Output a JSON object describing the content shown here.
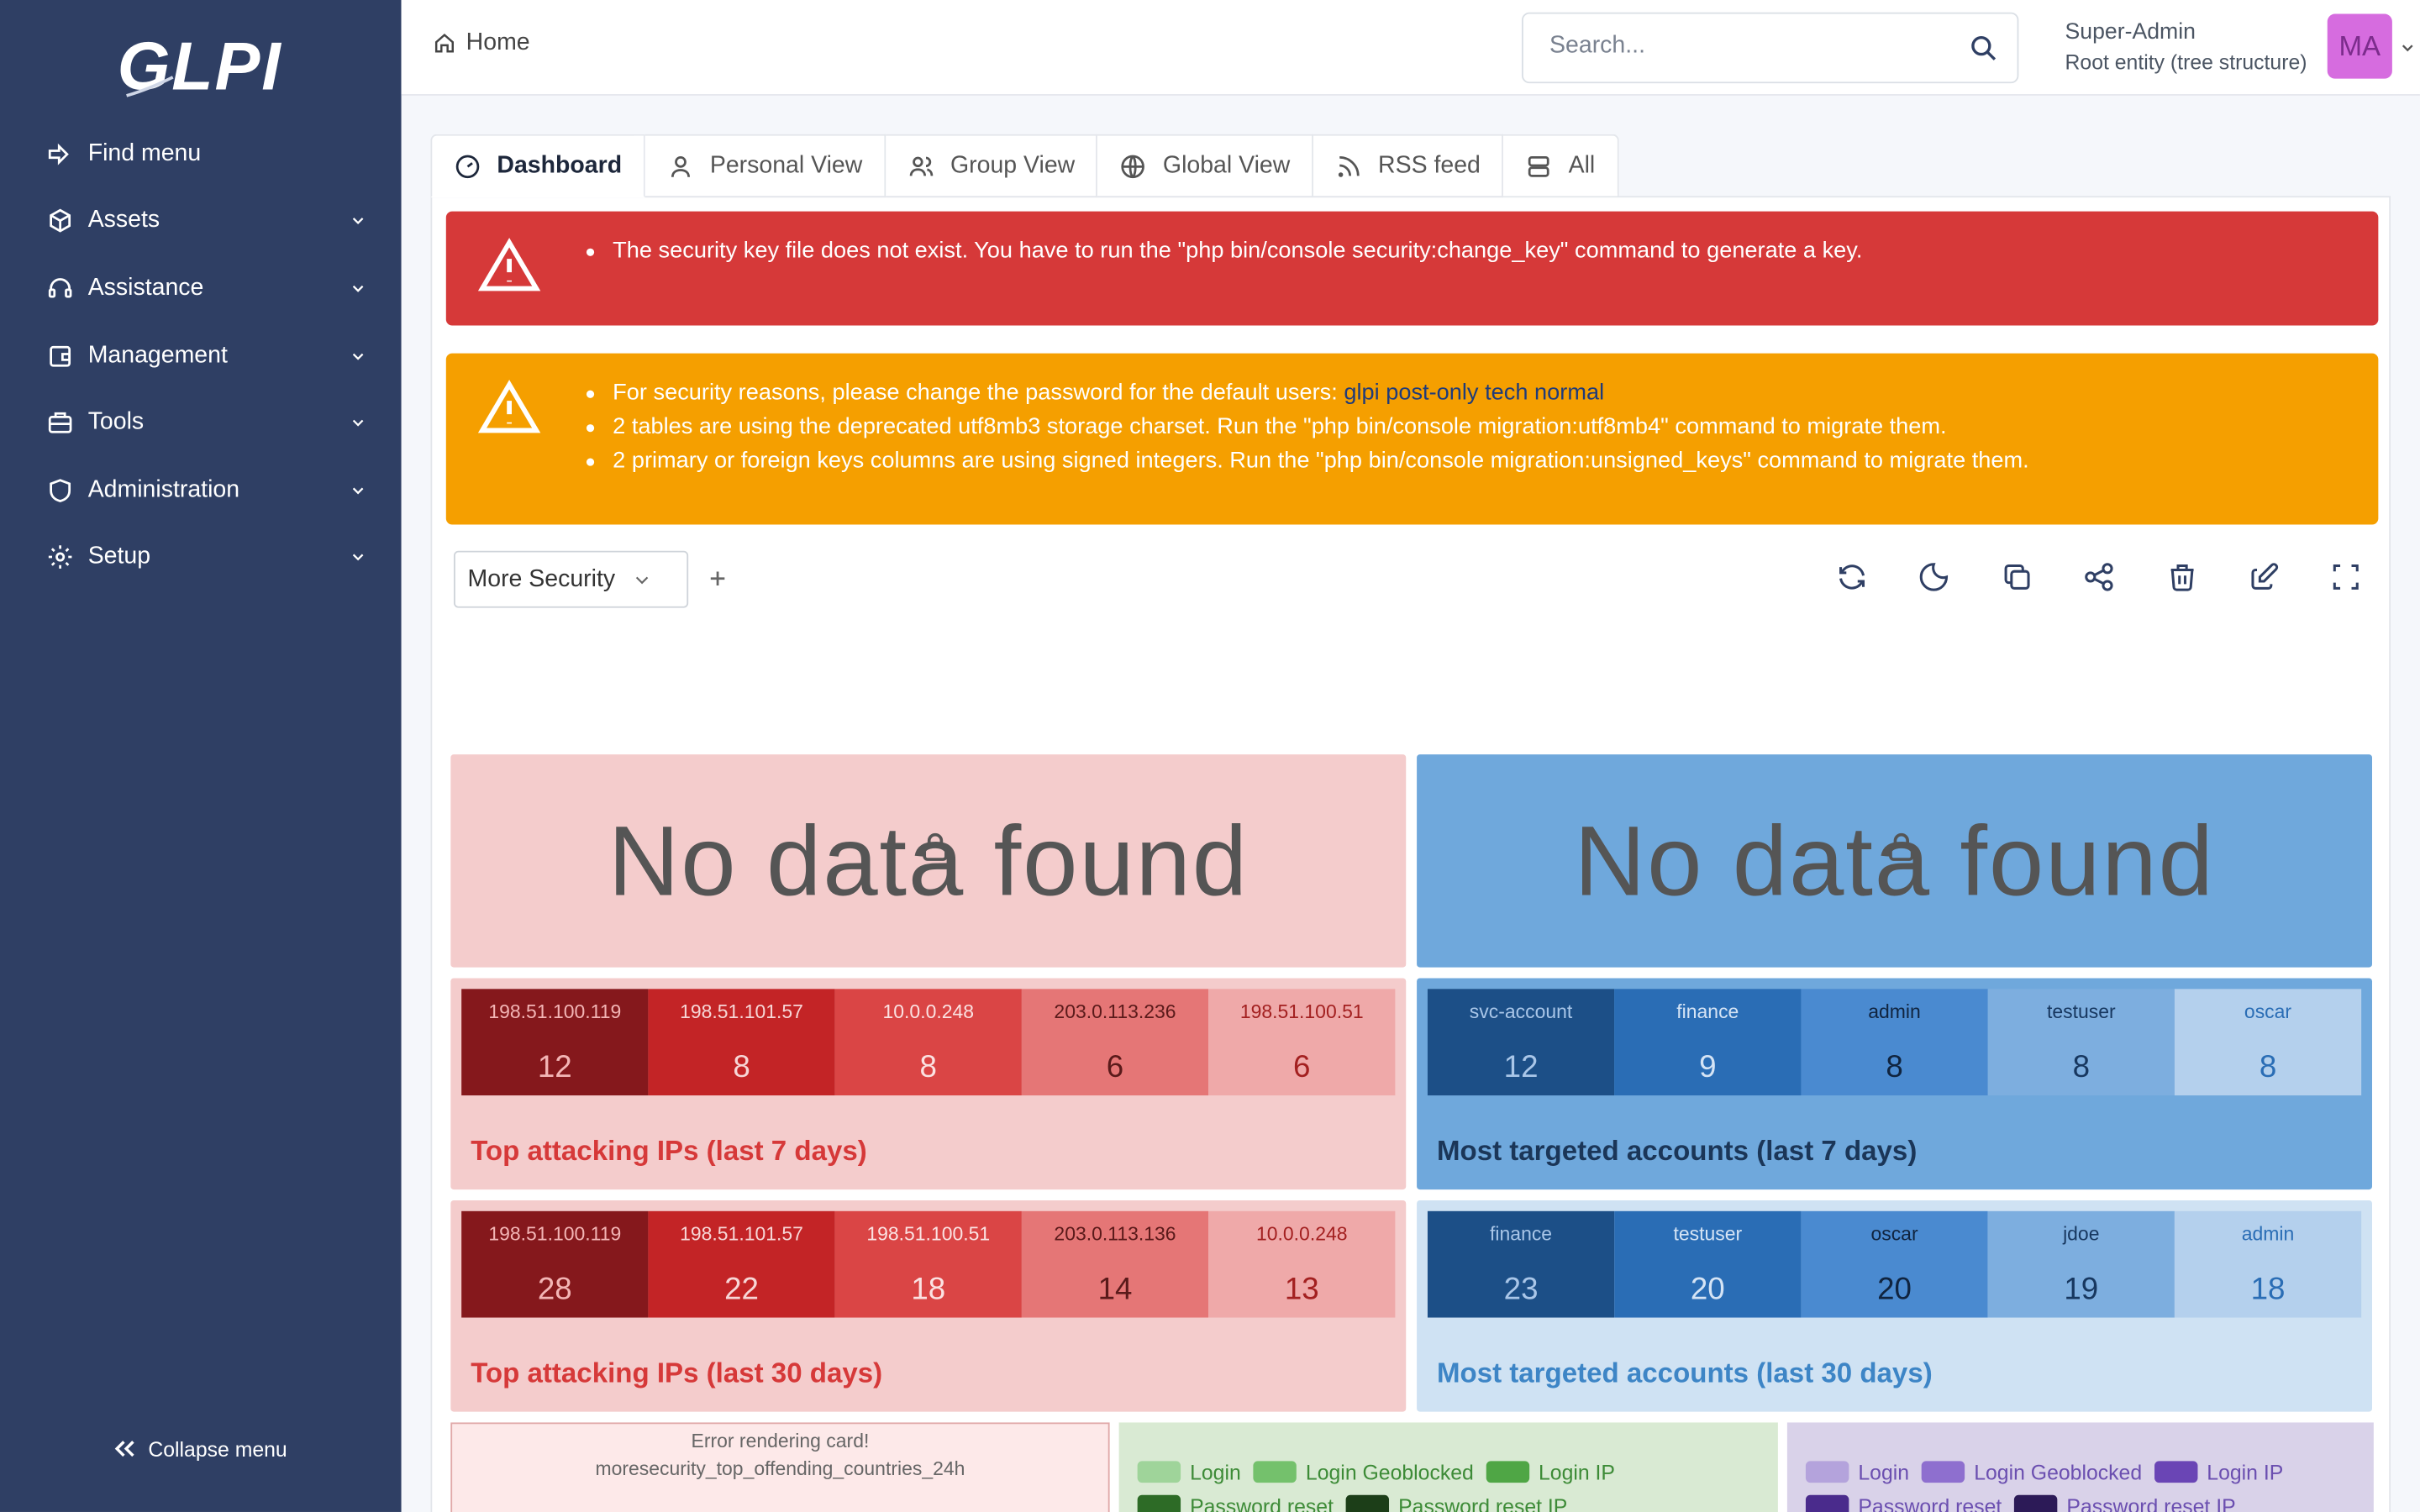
{
  "sidebar": {
    "logo": "GLPI",
    "items": [
      {
        "label": "Find menu",
        "icon": "sign-in-icon"
      },
      {
        "label": "Assets",
        "icon": "package-icon"
      },
      {
        "label": "Assistance",
        "icon": "headset-icon"
      },
      {
        "label": "Management",
        "icon": "wallet-icon"
      },
      {
        "label": "Tools",
        "icon": "briefcase-icon"
      },
      {
        "label": "Administration",
        "icon": "shield-icon"
      },
      {
        "label": "Setup",
        "icon": "gear-icon"
      }
    ],
    "collapse_label": "Collapse menu"
  },
  "header": {
    "breadcrumb": "Home",
    "search_placeholder": "Search...",
    "user_name": "Super-Admin",
    "entity": "Root entity (tree structure)",
    "avatar_initials": "MA"
  },
  "tabs": [
    {
      "label": "Dashboard",
      "icon": "dashboard-icon",
      "active": true
    },
    {
      "label": "Personal View",
      "icon": "user-icon"
    },
    {
      "label": "Group View",
      "icon": "users-icon"
    },
    {
      "label": "Global View",
      "icon": "globe-icon"
    },
    {
      "label": "RSS feed",
      "icon": "rss-icon"
    },
    {
      "label": "All",
      "icon": "list-icon"
    }
  ],
  "alerts": {
    "danger": [
      "The security key file does not exist. You have to run the \"php bin/console security:change_key\" command to generate a key."
    ],
    "warning": {
      "first_prefix": "For security reasons, please change the password for the default users: ",
      "first_users": [
        "glpi",
        "post-only",
        "tech",
        "normal"
      ],
      "rest": [
        "2 tables are using the deprecated utf8mb3 storage charset. Run the \"php bin/console migration:utf8mb4\" command to migrate them.",
        "2 primary or foreign keys columns are using signed integers. Run the \"php bin/console migration:unsigned_keys\" command to migrate them."
      ]
    }
  },
  "dashboard": {
    "selected": "More Security",
    "toolbar": [
      "refresh-icon",
      "moon-icon",
      "copy-icon",
      "share-icon",
      "trash-icon",
      "edit-icon",
      "fullscreen-icon"
    ]
  },
  "cards": {
    "nodata_text": "No data found",
    "ips_7": {
      "title": "Top attacking IPs (last 7 days)",
      "items": [
        {
          "label": "198.51.100.119",
          "value": "12"
        },
        {
          "label": "198.51.101.57",
          "value": "8"
        },
        {
          "label": "10.0.0.248",
          "value": "8"
        },
        {
          "label": "203.0.113.236",
          "value": "6"
        },
        {
          "label": "198.51.100.51",
          "value": "6"
        }
      ]
    },
    "accounts_7": {
      "title": "Most targeted accounts (last 7 days)",
      "items": [
        {
          "label": "svc-account",
          "value": "12"
        },
        {
          "label": "finance",
          "value": "9"
        },
        {
          "label": "admin",
          "value": "8"
        },
        {
          "label": "testuser",
          "value": "8"
        },
        {
          "label": "oscar",
          "value": "8"
        }
      ]
    },
    "ips_30": {
      "title": "Top attacking IPs (last 30 days)",
      "items": [
        {
          "label": "198.51.100.119",
          "value": "28"
        },
        {
          "label": "198.51.101.57",
          "value": "22"
        },
        {
          "label": "198.51.100.51",
          "value": "18"
        },
        {
          "label": "203.0.113.136",
          "value": "14"
        },
        {
          "label": "10.0.0.248",
          "value": "13"
        }
      ]
    },
    "accounts_30": {
      "title": "Most targeted accounts (last 30 days)",
      "items": [
        {
          "label": "finance",
          "value": "23"
        },
        {
          "label": "testuser",
          "value": "20"
        },
        {
          "label": "oscar",
          "value": "20"
        },
        {
          "label": "jdoe",
          "value": "19"
        },
        {
          "label": "admin",
          "value": "18"
        }
      ]
    },
    "error": {
      "line1": "Error rendering card!",
      "line2": "moresecurity_top_offending_countries_24h"
    },
    "legend_green": [
      "Login",
      "Login Geoblocked",
      "Login IP",
      "Password reset",
      "Password reset IP"
    ],
    "legend_purple": [
      "Login",
      "Login Geoblocked",
      "Login IP",
      "Password reset",
      "Password reset IP"
    ]
  },
  "colors": {
    "sidebar": "#2f3f64",
    "danger": "#d63939",
    "warning": "#f59f00",
    "red_card": "#f4cccc",
    "blue_card": "#6fa8dc",
    "light_blue_card": "#cfe2f3",
    "green_card": "#d9ead3",
    "purple_card": "#d9d2e9"
  }
}
